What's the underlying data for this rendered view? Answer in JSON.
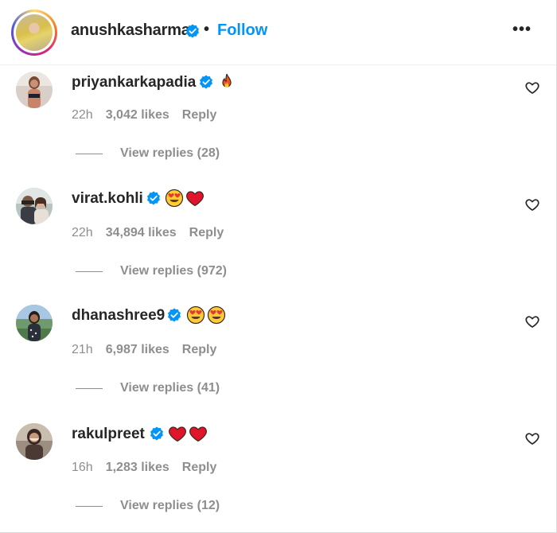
{
  "header": {
    "username": "anushkasharma",
    "separator": "•",
    "follow_label": "Follow",
    "more_label": "•••",
    "verified": true
  },
  "comments": [
    {
      "username": "priyankarkapadia",
      "verified": true,
      "emojis": [
        "fire"
      ],
      "time": "22h",
      "likes": "3,042 likes",
      "reply_label": "Reply",
      "view_replies": "View replies (28)"
    },
    {
      "username": "virat.kohli",
      "verified": true,
      "emojis": [
        "heart-eyes",
        "red-heart"
      ],
      "time": "22h",
      "likes": "34,894 likes",
      "reply_label": "Reply",
      "view_replies": "View replies (972)"
    },
    {
      "username": "dhanashree9",
      "verified": true,
      "emojis": [
        "heart-eyes",
        "heart-eyes"
      ],
      "time": "21h",
      "likes": "6,987 likes",
      "reply_label": "Reply",
      "view_replies": "View replies (41)"
    },
    {
      "username": "rakulpreet",
      "verified": true,
      "emojis": [
        "red-heart",
        "red-heart"
      ],
      "time": "16h",
      "likes": "1,283 likes",
      "reply_label": "Reply",
      "view_replies": "View replies (12)"
    }
  ],
  "colors": {
    "accent": "#0095f6",
    "verified": "#0095f6",
    "muted": "#8e8e8e",
    "text": "#262626"
  }
}
